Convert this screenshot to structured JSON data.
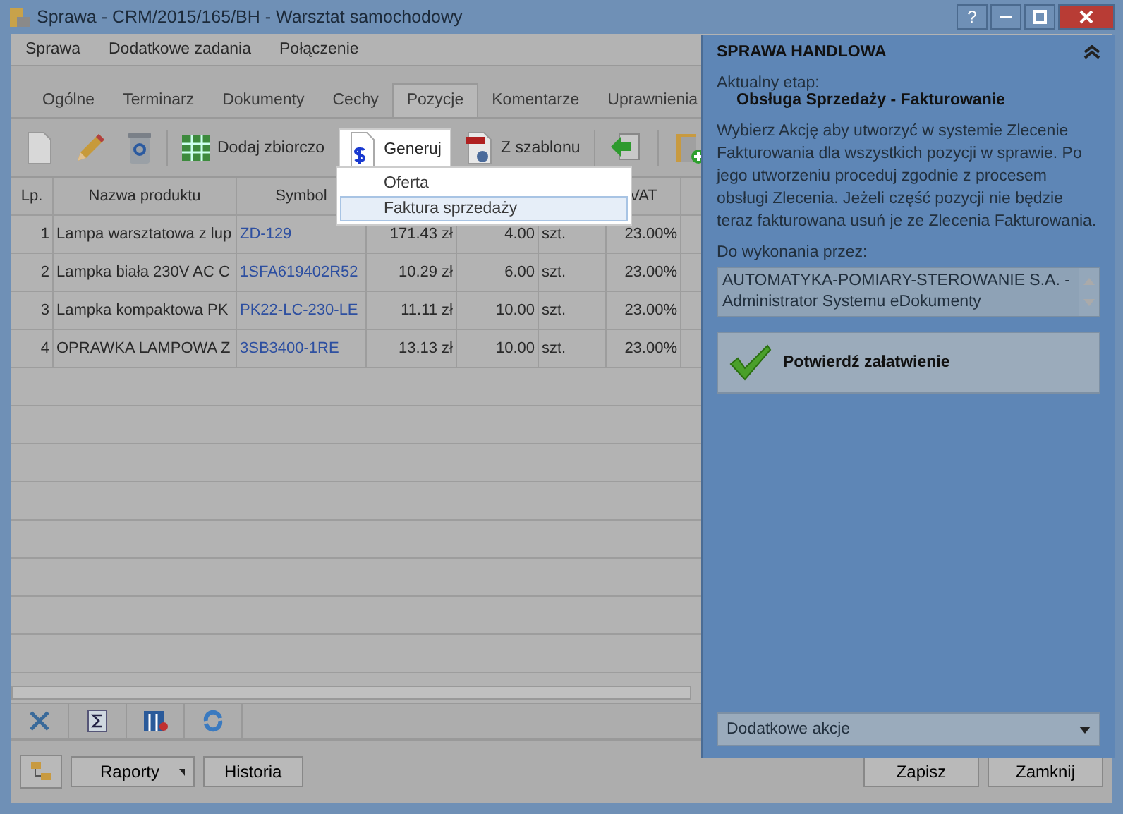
{
  "window": {
    "title": "Sprawa - CRM/2015/165/BH - Warsztat samochodowy",
    "controls": [
      "?"
    ]
  },
  "menu": [
    "Sprawa",
    "Dodatkowe zadania",
    "Połączenie"
  ],
  "tabs": [
    {
      "label": "Ogólne",
      "selected": false
    },
    {
      "label": "Terminarz",
      "selected": false
    },
    {
      "label": "Dokumenty",
      "selected": false
    },
    {
      "label": "Cechy",
      "selected": false
    },
    {
      "label": "Pozycje",
      "selected": true
    },
    {
      "label": "Komentarze",
      "selected": false
    },
    {
      "label": "Uprawnienia",
      "selected": false
    }
  ],
  "toolbar": [
    {
      "kind": "icon"
    },
    {
      "kind": "icon"
    },
    {
      "kind": "icon"
    },
    {
      "kind": "sep"
    },
    {
      "kind": "button",
      "label": "Dodaj zbiorczo"
    },
    {
      "kind": "menu",
      "label": "Generuj",
      "open": true
    },
    {
      "kind": "button",
      "label": "Z szablonu"
    },
    {
      "kind": "sep"
    },
    {
      "kind": "icon"
    },
    {
      "kind": "sep"
    },
    {
      "kind": "icon"
    }
  ],
  "generate_menu": [
    {
      "label": "Oferta",
      "selected": false
    },
    {
      "label": "Faktura sprzedaży",
      "selected": true
    }
  ],
  "table": {
    "columns": [
      "Lp.",
      "Nazwa produktu",
      "Symbol",
      "",
      "",
      "",
      "VAT"
    ],
    "rows": [
      {
        "cells": [
          "1",
          "Lampa warsztatowa z lup",
          "ZD-129",
          "171.43 zł",
          "4.00",
          "szt.",
          "23.00%"
        ]
      },
      {
        "cells": [
          "2",
          "Lampka biała 230V AC C",
          "1SFA619402R52",
          "10.29 zł",
          "6.00",
          "szt.",
          "23.00%"
        ]
      },
      {
        "cells": [
          "3",
          "Lampka kompaktowa PK",
          "PK22-LC-230-LE",
          "11.11 zł",
          "10.00",
          "szt.",
          "23.00%"
        ]
      },
      {
        "cells": [
          "4",
          "OPRAWKA LAMPOWA Z",
          "3SB3400-1RE",
          "13.13 zł",
          "10.00",
          "szt.",
          "23.00%"
        ]
      }
    ]
  },
  "footer": {
    "left": [
      "Raporty",
      "Historia"
    ],
    "right": [
      "Zapisz",
      "Zamknij"
    ]
  },
  "panel": {
    "title": "SPRAWA HANDLOWA",
    "stage_label": "Aktualny etap:",
    "stage": "Obsługa Sprzedaży - Fakturowanie",
    "description": "Wybierz Akcję aby utworzyć w systemie Zlecenie Fakturowania dla wszystkich pozycji w sprawie. Po jego utworzeniu proceduj zgodnie z procesem obsługi Zlecenia. Jeżeli część pozycji nie będzie teraz fakturowana usuń je ze Zlecenia Fakturowania.",
    "assignee_label": "Do wykonania przez:",
    "assignee": "AUTOMATYKA-POMIARY-STEROWANIE S.A. - Administrator Systemu eDokumenty",
    "confirm": "Potwierdź załatwienie",
    "actions": "Dodatkowe akcje"
  }
}
